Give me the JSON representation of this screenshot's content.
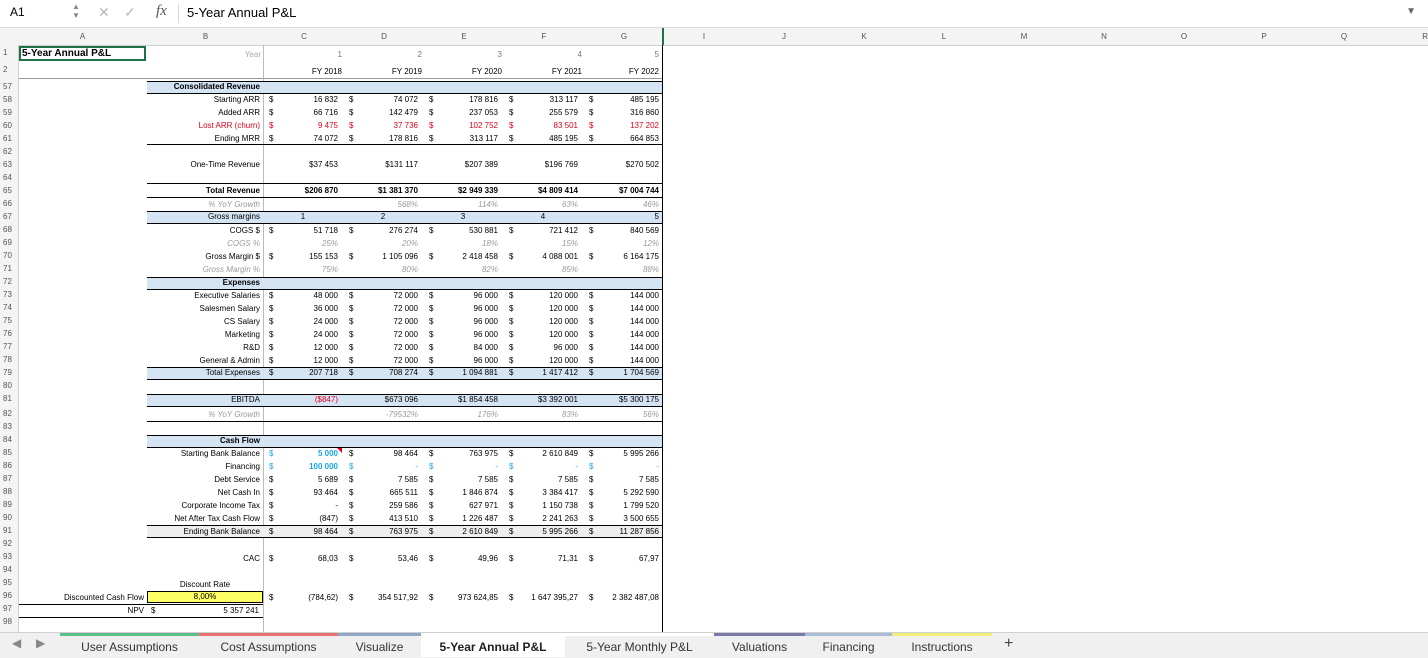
{
  "formula_bar": {
    "cell_ref": "A1",
    "fx": "fx",
    "formula": "5-Year Annual P&L"
  },
  "columns": [
    "A",
    "B",
    "C",
    "D",
    "E",
    "F",
    "G",
    "I",
    "J",
    "K",
    "L",
    "M",
    "N",
    "O",
    "P",
    "Q",
    "R"
  ],
  "row_numbers": [
    "1",
    "2",
    "57",
    "58",
    "59",
    "60",
    "61",
    "62",
    "63",
    "64",
    "65",
    "66",
    "67",
    "68",
    "69",
    "70",
    "71",
    "72",
    "73",
    "74",
    "75",
    "76",
    "77",
    "78",
    "79",
    "80",
    "81",
    "82",
    "83",
    "84",
    "85",
    "86",
    "87",
    "88",
    "89",
    "90",
    "91",
    "92",
    "93",
    "94",
    "95",
    "96",
    "97",
    "98"
  ],
  "header": {
    "title": "5-Year Annual P&L",
    "year_label": "Year",
    "years": [
      "1",
      "2",
      "3",
      "4",
      "5"
    ],
    "fiscal_years": [
      "FY 2018",
      "FY 2019",
      "FY 2020",
      "FY 2021",
      "FY 2022"
    ]
  },
  "revenue": {
    "section_title": "Consolidated Revenue",
    "starting_arr": {
      "label": "Starting ARR",
      "values": [
        "16 832",
        "74 072",
        "178 816",
        "313 117",
        "485 195"
      ]
    },
    "added_arr": {
      "label": "Added ARR",
      "values": [
        "66 716",
        "142 479",
        "237 053",
        "255 579",
        "316 860"
      ]
    },
    "lost_arr": {
      "label": "Lost ARR (churn)",
      "values": [
        "9 475",
        "37 736",
        "102 752",
        "83 501",
        "137 202"
      ]
    },
    "ending_mrr": {
      "label": "Ending MRR",
      "values": [
        "74 072",
        "178 816",
        "313 117",
        "485 195",
        "664 853"
      ]
    },
    "one_time": {
      "label": "One-Time Revenue",
      "values": [
        "$37 453",
        "$131 117",
        "$207 389",
        "$196 769",
        "$270 502"
      ]
    },
    "total": {
      "label": "Total Revenue",
      "values": [
        "$206 870",
        "$1 381 370",
        "$2 949 339",
        "$4 809 414",
        "$7 004 744"
      ]
    },
    "yoy": {
      "label": "% YoY Growth",
      "values": [
        "",
        "568%",
        "114%",
        "63%",
        "46%"
      ]
    }
  },
  "margins": {
    "section_title": "Gross margins",
    "index": [
      "1",
      "2",
      "3",
      "4",
      "5"
    ],
    "cogs": {
      "label": "COGS $",
      "values": [
        "51 718",
        "276 274",
        "530 881",
        "721 412",
        "840 569"
      ]
    },
    "cogs_pct": {
      "label": "COGS %",
      "values": [
        "25%",
        "20%",
        "18%",
        "15%",
        "12%"
      ]
    },
    "gm": {
      "label": "Gross Margin $",
      "values": [
        "155 153",
        "1 105 096",
        "2 418 458",
        "4 088 001",
        "6 164 175"
      ]
    },
    "gm_pct": {
      "label": "Gross Margin %",
      "values": [
        "75%",
        "80%",
        "82%",
        "85%",
        "88%"
      ]
    }
  },
  "expenses": {
    "section_title": "Expenses",
    "rows": [
      {
        "label": "Executive Salaries",
        "values": [
          "48 000",
          "72 000",
          "96 000",
          "120 000",
          "144 000"
        ]
      },
      {
        "label": "Salesmen Salary",
        "values": [
          "36 000",
          "72 000",
          "96 000",
          "120 000",
          "144 000"
        ]
      },
      {
        "label": "CS Salary",
        "values": [
          "24 000",
          "72 000",
          "96 000",
          "120 000",
          "144 000"
        ]
      },
      {
        "label": "Marketing",
        "values": [
          "24 000",
          "72 000",
          "96 000",
          "120 000",
          "144 000"
        ]
      },
      {
        "label": "R&D",
        "values": [
          "12 000",
          "72 000",
          "84 000",
          "96 000",
          "144 000"
        ]
      },
      {
        "label": "General & Admin",
        "values": [
          "12 000",
          "72 000",
          "96 000",
          "120 000",
          "144 000"
        ]
      }
    ],
    "total": {
      "label": "Total Expenses",
      "values": [
        "207 718",
        "708 274",
        "1 094 881",
        "1 417 412",
        "1 704 569"
      ]
    }
  },
  "ebitda": {
    "label": "EBITDA",
    "values": [
      "($847)",
      "$673 096",
      "$1 854 458",
      "$3 392 001",
      "$5 300 175"
    ],
    "yoy": {
      "label": "% YoY Growth",
      "values": [
        "",
        "-79532%",
        "176%",
        "83%",
        "56%"
      ]
    }
  },
  "cashflow": {
    "section_title": "Cash Flow",
    "start": {
      "label": "Starting Bank Balance",
      "values": [
        "5 000",
        "98 464",
        "763 975",
        "2 610 849",
        "5 995 266"
      ]
    },
    "financing": {
      "label": "Financing",
      "values": [
        "100 000",
        "-",
        "-",
        "-",
        "-"
      ]
    },
    "debt": {
      "label": "Debt Service",
      "values": [
        "5 689",
        "7 585",
        "7 585",
        "7 585",
        "7 585"
      ]
    },
    "net_cash": {
      "label": "Net Cash In",
      "values": [
        "93 464",
        "665 511",
        "1 846 874",
        "3 384 417",
        "5 292 590"
      ]
    },
    "tax": {
      "label": "Corporate Income Tax",
      "values": [
        "-",
        "259 586",
        "627 971",
        "1 150 738",
        "1 799 520"
      ]
    },
    "after_tax": {
      "label": "Net After Tax Cash Flow",
      "values": [
        "(847)",
        "413 510",
        "1 226 487",
        "2 241 263",
        "3 500 655"
      ]
    },
    "end": {
      "label": "Ending Bank Balance",
      "values": [
        "98 464",
        "763 975",
        "2 610 849",
        "5 995 266",
        "11 287 856"
      ]
    }
  },
  "cac": {
    "label": "CAC",
    "values": [
      "68,03",
      "53,46",
      "49,96",
      "71,31",
      "67,97"
    ]
  },
  "dcf": {
    "discount_label": "Discount Rate",
    "discount_value": "8,00%",
    "label": "Discounted Cash Flow",
    "values": [
      "(784,62)",
      "354 517,92",
      "973 624,85",
      "1 647 395,27",
      "2 382 487,08"
    ],
    "npv_label": "NPV",
    "npv_value": "5 357 241"
  },
  "currency": "$",
  "tabs": [
    {
      "label": "User Assumptions",
      "color": "#5cbf8a"
    },
    {
      "label": "Cost Assumptions",
      "color": "#e77070"
    },
    {
      "label": "Visualize",
      "color": "#8fa8c8"
    },
    {
      "label": "5-Year Annual P&L",
      "color": "#ffffff",
      "active": true
    },
    {
      "label": "5-Year Monthly P&L",
      "color": "#ffffff"
    },
    {
      "label": "Valuations",
      "color": "#7a78a8"
    },
    {
      "label": "Financing",
      "color": "#a8bcd8"
    },
    {
      "label": "Instructions",
      "color": "#efef7a"
    }
  ],
  "add_sheet": "+"
}
